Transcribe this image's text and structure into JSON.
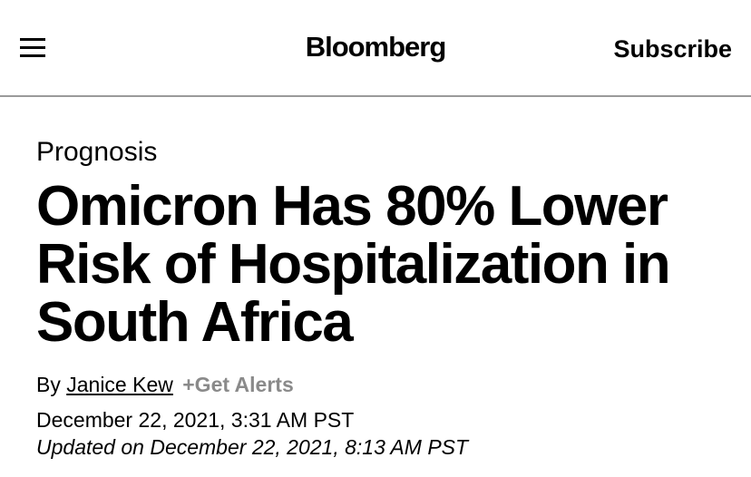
{
  "header": {
    "menu_icon": "hamburger-menu-icon",
    "logo": "Bloomberg",
    "subscribe_label": "Subscribe"
  },
  "article": {
    "kicker": "Prognosis",
    "headline": "Omicron Has 80% Lower Risk of Hospitalization in South Africa",
    "byline_prefix": "By",
    "author": "Janice Kew",
    "alerts_label": "+Get Alerts",
    "published": "December 22, 2021, 3:31 AM PST",
    "updated_prefix": "Updated on",
    "updated": "December 22, 2021, 8:13 AM PST"
  },
  "colors": {
    "text": "#000000",
    "muted": "#8a8a8a",
    "divider": "#9a9a9a",
    "background": "#ffffff"
  }
}
